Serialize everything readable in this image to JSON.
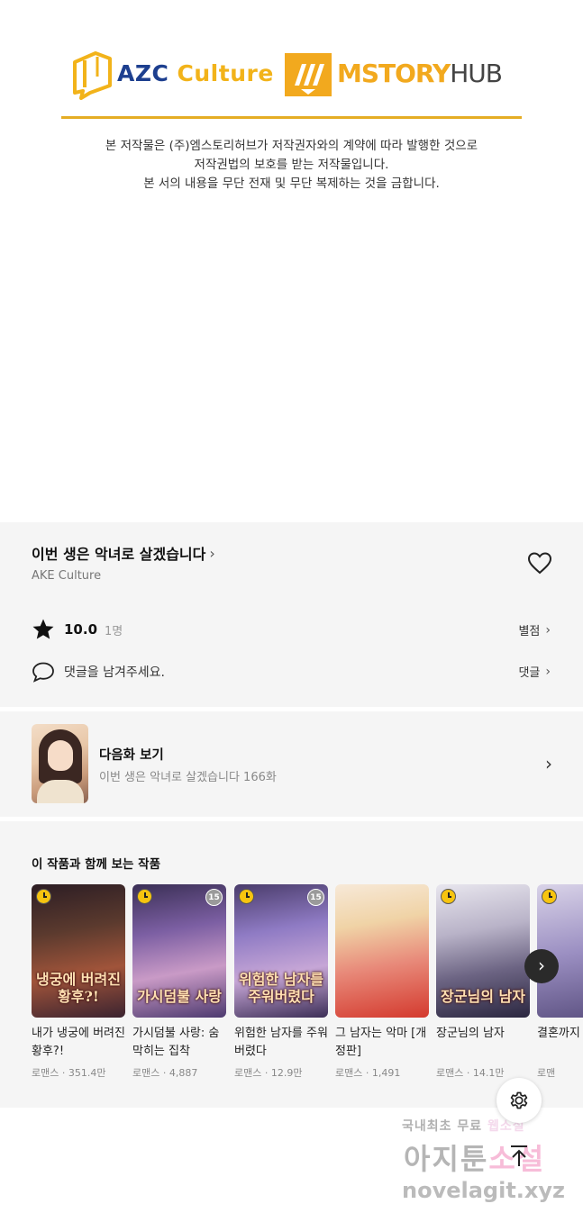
{
  "logos": {
    "azc_prefix": "AZC ",
    "azc_suffix": "Culture",
    "mstory_prefix": "MSTORY",
    "mstory_suffix": "HUB"
  },
  "notice": {
    "line1": "본 저작물은 (주)엠스토리허브가 저작권자와의 계약에 따라 발행한 것으로",
    "line2": "저작권법의 보호를 받는 저작물입니다.",
    "line3": "본 서의 내용을 무단 전재 및 무단 복제하는 것을 금합니다."
  },
  "work": {
    "title": "이번 생은 악녀로 살겠습니다",
    "author": "AKE Culture",
    "rating": "10.0",
    "rating_count": "1명",
    "score_link": "별점",
    "comment_prompt": "댓글을 남겨주세요.",
    "comment_link": "댓글"
  },
  "next_episode": {
    "label": "다음화 보기",
    "subtitle": "이번 생은 악녀로 살겠습니다 166화"
  },
  "recommendations": {
    "heading": "이 작품과 함께 보는 작품",
    "items": [
      {
        "title": "내가 냉궁에 버려진 황후?!",
        "genre": "로맨스",
        "views": "351.4만",
        "cover_text": "냉궁에 버려진 황후?!",
        "age": ""
      },
      {
        "title": "가시덤불 사랑: 숨 막히는 집착",
        "genre": "로맨스",
        "views": "4,887",
        "cover_text": "가시덤불 사랑",
        "age": "15"
      },
      {
        "title": "위험한 남자를 주워버렸다",
        "genre": "로맨스",
        "views": "12.9만",
        "cover_text": "위험한 남자를 주워버렸다",
        "age": "15"
      },
      {
        "title": "그 남자는 악마 [개정판]",
        "genre": "로맨스",
        "views": "1,491",
        "cover_text": "",
        "age": ""
      },
      {
        "title": "장군님의 남자",
        "genre": "로맨스",
        "views": "14.1만",
        "cover_text": "장군님의 남자",
        "age": ""
      },
      {
        "title": "결혼까지",
        "genre": "로맨",
        "views": "",
        "cover_text": "",
        "age": ""
      }
    ],
    "separator": "·"
  },
  "watermark": {
    "line1_a": "국내최초 무료 ",
    "line1_b": "웹소설",
    "line2_a": "아지툰",
    "line2_b": "소설",
    "line3": "novelagit.xyz"
  },
  "colors": {
    "accent_gold": "#e5ad24",
    "azc_blue": "#1d3f8f",
    "mstory_orange": "#f2a91e",
    "section_bg": "#f5f5f5"
  },
  "icons": [
    "heart-icon",
    "star-icon",
    "comment-icon",
    "chevron-right-icon",
    "gear-icon",
    "arrow-up-icon",
    "clock-icon"
  ]
}
